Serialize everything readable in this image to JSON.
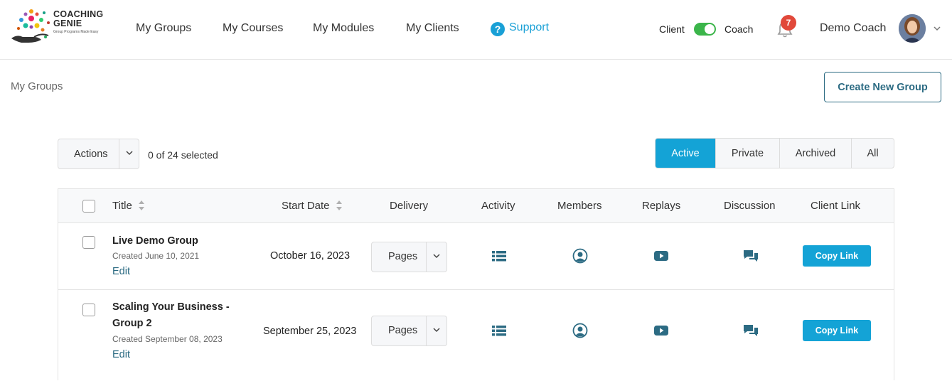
{
  "brand": {
    "line1": "COACHING",
    "line2": "GENIE",
    "tagline": "Group Programs Made Easy"
  },
  "nav": {
    "groups": "My Groups",
    "courses": "My Courses",
    "modules": "My Modules",
    "clients": "My Clients",
    "support": "Support"
  },
  "role": {
    "client": "Client",
    "coach": "Coach",
    "toggle_on": "Coach"
  },
  "notifications": {
    "count": "7"
  },
  "user": {
    "name": "Demo Coach"
  },
  "page": {
    "breadcrumb": "My Groups",
    "create_button": "Create New Group"
  },
  "toolbar": {
    "actions_label": "Actions",
    "selected_count": "0 of 24 selected"
  },
  "filters": [
    "Active",
    "Private",
    "Archived",
    "All"
  ],
  "active_filter": "Active",
  "table": {
    "headers": {
      "title": "Title",
      "start_date": "Start Date",
      "delivery": "Delivery",
      "activity": "Activity",
      "members": "Members",
      "replays": "Replays",
      "discussion": "Discussion",
      "client_link": "Client Link"
    },
    "rows": [
      {
        "title": "Live Demo Group",
        "created": "Created June 10, 2021",
        "edit": "Edit",
        "start_date": "October 16, 2023",
        "delivery": "Pages",
        "copy": "Copy Link"
      },
      {
        "title": "Scaling Your Business - Group 2",
        "created": "Created September 08, 2023",
        "edit": "Edit",
        "start_date": "September 25, 2023",
        "delivery": "Pages",
        "copy": "Copy Link"
      }
    ]
  },
  "colors": {
    "accent": "#14a3d6",
    "link": "#2c6b83",
    "toggle": "#3bb54a",
    "badge": "#e1483a",
    "icon": "#2c6b83"
  }
}
